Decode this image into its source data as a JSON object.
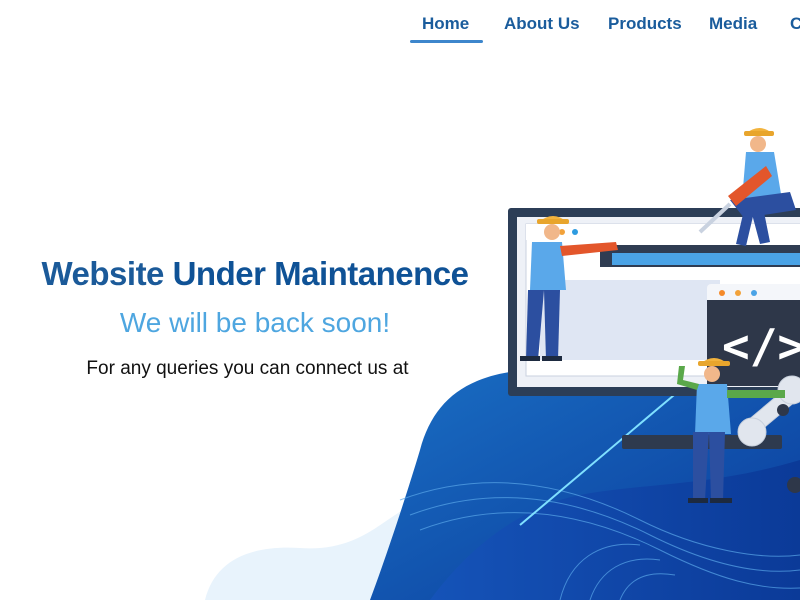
{
  "nav": {
    "items": [
      {
        "label": "Home",
        "active": true
      },
      {
        "label": "About Us"
      },
      {
        "label": "Products"
      },
      {
        "label": "Media"
      },
      {
        "label": "C"
      }
    ]
  },
  "hero": {
    "title_part1": "Website",
    "title_part2": "Under Maintanence",
    "subtitle": "We will be back soon!",
    "contact_text": "For any queries you can connect us at"
  },
  "illustration": {
    "code_symbol": "</>"
  },
  "colors": {
    "nav_text": "#1a5c9c",
    "nav_active_underline": "#3d86cc",
    "title": "#0f5296",
    "subtitle": "#4ea6e0",
    "wave_dark": "#0a3f9e",
    "wave_light": "#e6f2fb"
  }
}
